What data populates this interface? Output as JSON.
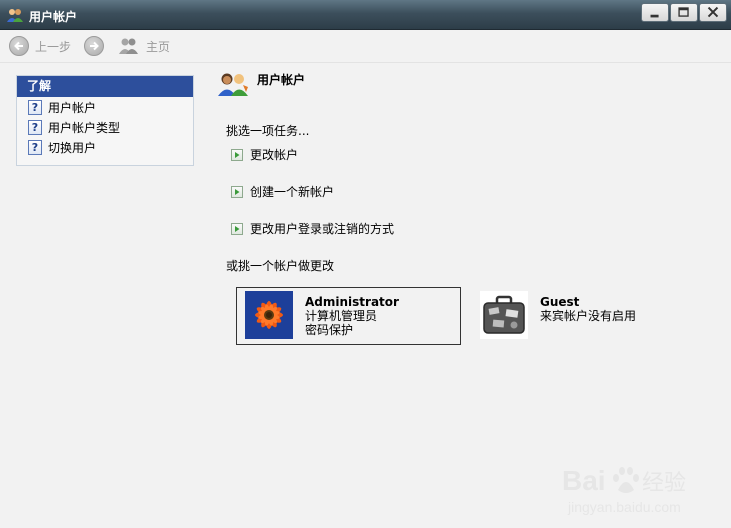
{
  "window": {
    "title": "用户帐户"
  },
  "toolbar": {
    "back_label": "上一步",
    "home_label": "主页"
  },
  "taskpane": {
    "header": "了解",
    "items": [
      {
        "label": "用户帐户"
      },
      {
        "label": "用户帐户类型"
      },
      {
        "label": "切换用户"
      }
    ]
  },
  "main": {
    "title": "用户帐户",
    "pick_task": "挑选一项任务...",
    "tasks": [
      {
        "label": "更改帐户"
      },
      {
        "label": "创建一个新帐户"
      },
      {
        "label": "更改用户登录或注销的方式"
      }
    ],
    "pick_account": "或挑一个帐户做更改",
    "accounts": [
      {
        "name": "Administrator",
        "line1": "计算机管理员",
        "line2": "密码保护"
      },
      {
        "name": "Guest",
        "line1": "来宾帐户没有启用"
      }
    ]
  },
  "watermark": {
    "brand": "Bai",
    "brand_suffix": "经验",
    "url": "jingyan.baidu.com"
  },
  "icons": {
    "title": "users-icon",
    "back": "arrow-left-icon",
    "forward": "arrow-right-icon",
    "home": "users-home-icon",
    "help": "help-icon",
    "task_arrow": "green-arrow-icon",
    "admin_picture": "flower-icon",
    "guest_picture": "suitcase-icon"
  },
  "colors": {
    "titlebar": "#3c4f5c",
    "taskpane_header": "#2d4f9c",
    "task_arrow": "#3a9a3a",
    "background": "#f2f2f2"
  }
}
